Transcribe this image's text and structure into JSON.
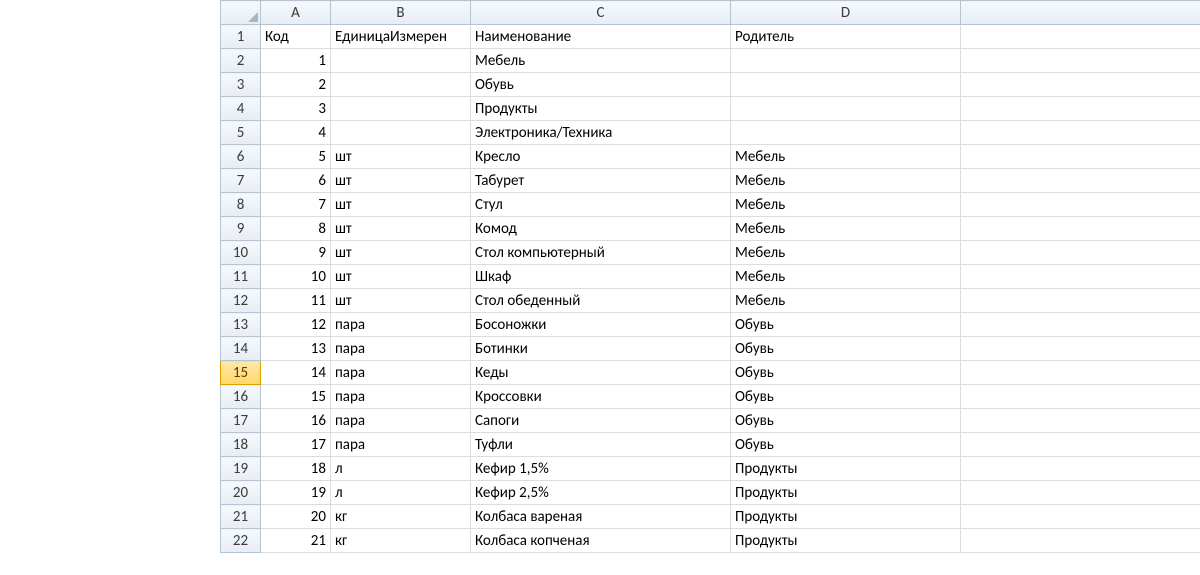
{
  "columns": [
    "A",
    "B",
    "C",
    "D"
  ],
  "extraColumn": "",
  "selectedRowHeader": 15,
  "headerRow": {
    "A": "Код",
    "B": "ЕдиницаИзмерен",
    "C": "Наименование",
    "D": "Родитель"
  },
  "rows": [
    {
      "n": 1,
      "A": "Код",
      "B": "ЕдиницаИзмерен",
      "C": "Наименование",
      "D": "Родитель"
    },
    {
      "n": 2,
      "A": "1",
      "B": "",
      "C": "Мебель",
      "D": ""
    },
    {
      "n": 3,
      "A": "2",
      "B": "",
      "C": "Обувь",
      "D": ""
    },
    {
      "n": 4,
      "A": "3",
      "B": "",
      "C": "Продукты",
      "D": ""
    },
    {
      "n": 5,
      "A": "4",
      "B": "",
      "C": "Электроника/Техника",
      "D": ""
    },
    {
      "n": 6,
      "A": "5",
      "B": "шт",
      "C": "Кресло",
      "D": "Мебель"
    },
    {
      "n": 7,
      "A": "6",
      "B": "шт",
      "C": "Табурет",
      "D": "Мебель"
    },
    {
      "n": 8,
      "A": "7",
      "B": "шт",
      "C": "Стул",
      "D": "Мебель"
    },
    {
      "n": 9,
      "A": "8",
      "B": "шт",
      "C": "Комод",
      "D": "Мебель"
    },
    {
      "n": 10,
      "A": "9",
      "B": "шт",
      "C": "Стол компьютерный",
      "D": "Мебель"
    },
    {
      "n": 11,
      "A": "10",
      "B": "шт",
      "C": "Шкаф",
      "D": "Мебель"
    },
    {
      "n": 12,
      "A": "11",
      "B": "шт",
      "C": "Стол обеденный",
      "D": "Мебель"
    },
    {
      "n": 13,
      "A": "12",
      "B": "пара",
      "C": "Босоножки",
      "D": "Обувь"
    },
    {
      "n": 14,
      "A": "13",
      "B": "пара",
      "C": "Ботинки",
      "D": "Обувь"
    },
    {
      "n": 15,
      "A": "14",
      "B": "пара",
      "C": "Кеды",
      "D": "Обувь"
    },
    {
      "n": 16,
      "A": "15",
      "B": "пара",
      "C": "Кроссовки",
      "D": "Обувь"
    },
    {
      "n": 17,
      "A": "16",
      "B": "пара",
      "C": "Сапоги",
      "D": "Обувь"
    },
    {
      "n": 18,
      "A": "17",
      "B": "пара",
      "C": "Туфли",
      "D": "Обувь"
    },
    {
      "n": 19,
      "A": "18",
      "B": "л",
      "C": "Кефир 1,5%",
      "D": "Продукты"
    },
    {
      "n": 20,
      "A": "19",
      "B": "л",
      "C": "Кефир 2,5%",
      "D": "Продукты"
    },
    {
      "n": 21,
      "A": "20",
      "B": "кг",
      "C": "Колбаса вареная",
      "D": "Продукты"
    },
    {
      "n": 22,
      "A": "21",
      "B": "кг",
      "C": "Колбаса копченая",
      "D": "Продукты"
    }
  ]
}
